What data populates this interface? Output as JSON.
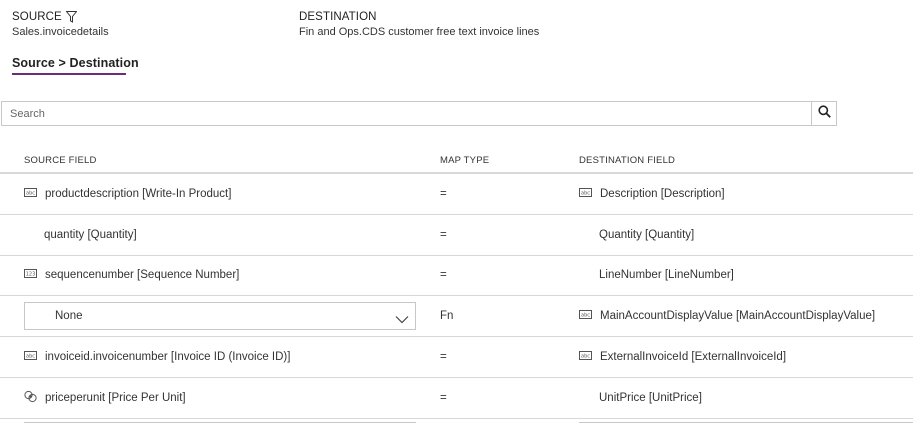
{
  "header": {
    "source_label": "SOURCE",
    "source_value": "Sales.invoicedetails",
    "destination_label": "DESTINATION",
    "destination_value": "Fin and Ops.CDS customer free text invoice lines"
  },
  "tab": {
    "label": "Source > Destination"
  },
  "search": {
    "placeholder": "Search"
  },
  "columns": {
    "source": "SOURCE FIELD",
    "map_type": "MAP TYPE",
    "destination": "DESTINATION FIELD"
  },
  "rows": [
    {
      "source": "productdescription [Write-In Product]",
      "source_icon": "text-field-icon",
      "map_type": "=",
      "destination": "Description [Description]",
      "destination_icon": "text-field-icon"
    },
    {
      "source": "quantity [Quantity]",
      "source_icon": "",
      "map_type": "=",
      "destination": "Quantity [Quantity]",
      "destination_icon": ""
    },
    {
      "source": "sequencenumber [Sequence Number]",
      "source_icon": "number-field-icon",
      "map_type": "=",
      "destination": "LineNumber [LineNumber]",
      "destination_icon": ""
    },
    {
      "source": "None",
      "source_icon": "",
      "source_is_dropdown": true,
      "map_type": "Fn",
      "destination": "MainAccountDisplayValue [MainAccountDisplayValue]",
      "destination_icon": "text-field-icon"
    },
    {
      "source": "invoiceid.invoicenumber [Invoice ID (Invoice ID)]",
      "source_icon": "text-field-icon",
      "map_type": "=",
      "destination": "ExternalInvoiceId [ExternalInvoiceId]",
      "destination_icon": "text-field-icon"
    },
    {
      "source": "priceperunit [Price Per Unit]",
      "source_icon": "currency-field-icon",
      "map_type": "=",
      "destination": "UnitPrice [UnitPrice]",
      "destination_icon": ""
    }
  ],
  "colors": {
    "accent": "#6b2d7a",
    "border": "#c8c8c8",
    "divider": "#d8d8d8"
  }
}
